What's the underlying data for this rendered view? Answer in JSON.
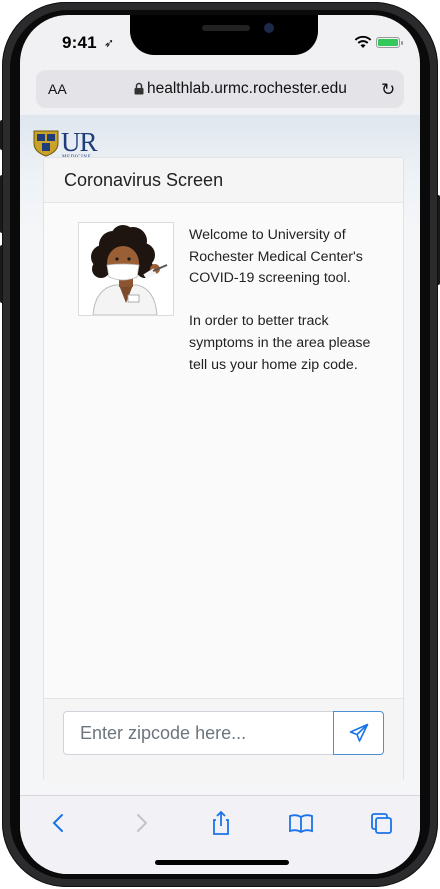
{
  "status_bar": {
    "time": "9:41",
    "location_glyph": "➶"
  },
  "url_bar": {
    "text_size_label": "AA",
    "url": "healthlab.urmc.rochester.edu",
    "reload_glyph": "↻"
  },
  "brand": {
    "logo_text": "UR",
    "logo_subtext": "MEDICINE"
  },
  "card": {
    "title": "Coronavirus Screen",
    "message_paragraph_1": "Welcome to University of Rochester Medical Center's COVID-19 screening tool.",
    "message_paragraph_2": "In order to better track symptoms in the area please tell us your home zip code."
  },
  "input": {
    "placeholder": "Enter zipcode here...",
    "value": ""
  },
  "toolbar": {
    "items": [
      "back-icon",
      "forward-icon",
      "share-icon",
      "bookmarks-icon",
      "tabs-icon"
    ]
  },
  "colors": {
    "accent": "#1a73e8",
    "brand_navy": "#1f3d7a",
    "send_border": "#4a90d9"
  }
}
